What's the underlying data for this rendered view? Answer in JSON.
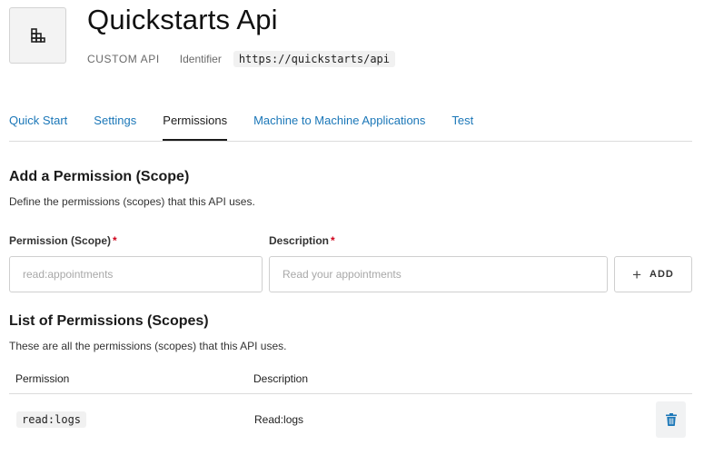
{
  "header": {
    "title": "Quickstarts Api",
    "type_label": "CUSTOM API",
    "identifier_label": "Identifier",
    "identifier_value": "https://quickstarts/api",
    "logo_icon": "building-icon"
  },
  "tabs": [
    {
      "label": "Quick Start",
      "active": false
    },
    {
      "label": "Settings",
      "active": false
    },
    {
      "label": "Permissions",
      "active": true
    },
    {
      "label": "Machine to Machine Applications",
      "active": false
    },
    {
      "label": "Test",
      "active": false
    }
  ],
  "add_section": {
    "heading": "Add a Permission (Scope)",
    "description": "Define the permissions (scopes) that this API uses.",
    "permission_label": "Permission (Scope)",
    "permission_placeholder": "read:appointments",
    "permission_value": "",
    "description_label": "Description",
    "description_placeholder": "Read your appointments",
    "description_value": "",
    "required_marker": "*",
    "add_button": "ADD",
    "add_icon": "plus-icon"
  },
  "list_section": {
    "heading": "List of Permissions (Scopes)",
    "description": "These are all the permissions (scopes) that this API uses.",
    "columns": [
      "Permission",
      "Description"
    ],
    "rows": [
      {
        "permission": "read:logs",
        "description": "Read:logs",
        "action_icon": "trash-icon"
      }
    ]
  },
  "colors": {
    "link": "#1b77b8",
    "required": "#d0021b",
    "delete_icon": "#1b77b8"
  }
}
